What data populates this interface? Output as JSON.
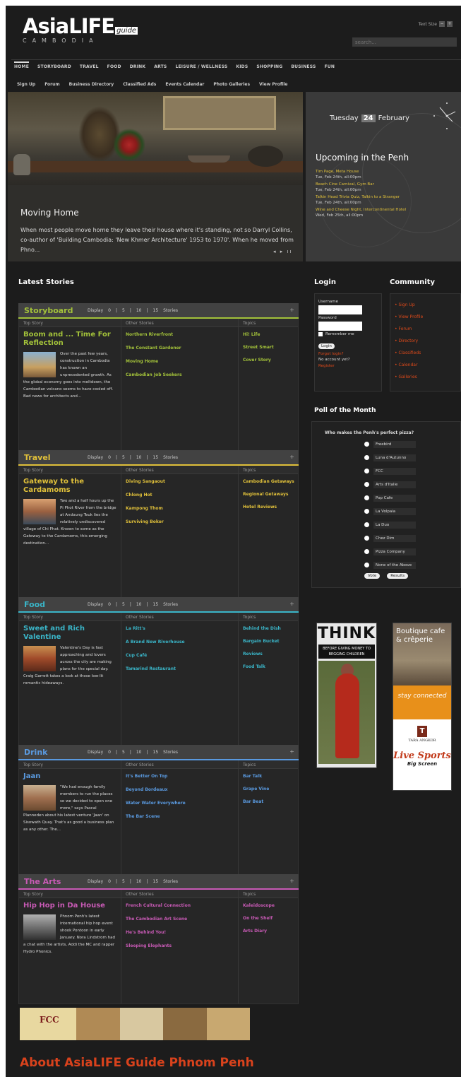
{
  "header": {
    "logo": "AsiaLIFE",
    "logo_guide": "guide",
    "logo_sub": "CAMBODIA",
    "text_size_label": "Text Size",
    "text_minus": "−",
    "text_plus": "+",
    "search_placeholder": "search..."
  },
  "nav": [
    "HOME",
    "STORYBOARD",
    "TRAVEL",
    "FOOD",
    "DRINK",
    "ARTS",
    "LEISURE / WELLNESS",
    "KIDS",
    "SHOPPING",
    "BUSINESS",
    "FUN"
  ],
  "subnav": [
    "Sign Up",
    "Forum",
    "Business Directory",
    "Classified Ads",
    "Events Calendar",
    "Photo Galleries",
    "View Profile"
  ],
  "hero": {
    "title": "Moving Home",
    "text": "When most people move home they leave their house where it's standing, not so Darryl Collins, co-author of 'Building Cambodia: 'New Khmer Architecture' 1953 to 1970'. When he moved from Phno...",
    "arrows": "◂ ▸ ıı"
  },
  "upcoming": {
    "day": "Tuesday",
    "date_num": "24",
    "month": "February",
    "title": "Upcoming in the Penh",
    "events": [
      {
        "name": "Tim Page, Meta House",
        "date": "Tue, Feb 24th, all:00pm"
      },
      {
        "name": "Beach Cine Carnival, Gym Bar",
        "date": "Tue, Feb 24th, all:00pm"
      },
      {
        "name": "Talkin Head Trivia Quiz, Talkin to a Stranger",
        "date": "Tue, Feb 24th, all:00pm"
      },
      {
        "name": "Wine and Cheese Night, Intercontinental Hotel",
        "date": "Wed, Feb 25th, all:00pm"
      }
    ]
  },
  "latest_title": "Latest Stories",
  "sections": [
    {
      "title": "Storyboard",
      "color": "#a3c23a",
      "display": "Display",
      "counts": [
        "0",
        "|",
        "5",
        "|",
        "10",
        "|",
        "15",
        "Stories"
      ],
      "col_top": "Top Story",
      "col_other": "Other Stories",
      "col_topics": "Topics",
      "top_title": "Boom and ... Time For Reflection",
      "top_text": "Over the past few years, construction in Cambodia has known an unprecedented growth. As the global economy goes into meltdown, the Cambodian volcano seems to have cooled off. Bad news for architects and...",
      "others": [
        "Northern Riverfront",
        "The Constant Gardener",
        "Moving Home",
        "Cambodian Job Seekers"
      ],
      "topics": [
        "Hi! Life",
        "Street Smart",
        "Cover Story"
      ]
    },
    {
      "title": "Travel",
      "color": "#e0c03a",
      "display": "Display",
      "counts": [
        "0",
        "|",
        "5",
        "|",
        "10",
        "|",
        "15",
        "Stories"
      ],
      "col_top": "Top Story",
      "col_other": "Other Stories",
      "col_topics": "Topics",
      "top_title": "Gateway to the Cardamoms",
      "top_text": "Two and a half hours up the Pi Phot River from the bridge at Andoung Teuk lies the relatively undiscovered village of Chi Phat. Known to some as the Gateway to the Cardamoms, this emerging destination...",
      "others": [
        "Diving Sangaout",
        "Chlong Hot",
        "Kampong Thom",
        "Surviving Bokor"
      ],
      "topics": [
        "Cambodian Getaways",
        "Regional Getaways",
        "Hotel Reviews"
      ]
    },
    {
      "title": "Food",
      "color": "#3ab5c8",
      "display": "Display",
      "counts": [
        "0",
        "|",
        "5",
        "|",
        "10",
        "|",
        "15",
        "Stories"
      ],
      "col_top": "Top Story",
      "col_other": "Other Stories",
      "col_topics": "Topics",
      "top_title": "Sweet and Rich Valentine",
      "top_text": "Valentine's Day is fast approaching and lovers across the city are making plans for the special day. Craig Garrett takes a look at those low-lit romantic hideaways.",
      "others": [
        "La Ritt's",
        "A Brand New Riverhouse",
        "Cup Café",
        "Tamarind Restaurant"
      ],
      "topics": [
        "Behind the Dish",
        "Bargain Bucket",
        "Reviews",
        "Food Talk"
      ]
    },
    {
      "title": "Drink",
      "color": "#5a9ae0",
      "display": "Display",
      "counts": [
        "0",
        "|",
        "5",
        "|",
        "10",
        "|",
        "15",
        "Stories"
      ],
      "col_top": "Top Story",
      "col_other": "Other Stories",
      "col_topics": "Topics",
      "top_title": "Jaan",
      "top_text": "\"We had enough family members to run the places so we decided to open one more,\" says Pascal Planneden about his latest venture 'Jaan' on Sisowath Quay. That's as good a business plan as any other. The...",
      "others": [
        "It's Better On Top",
        "Beyond Bordeaux",
        "Water Water Everywhere",
        "The Bar Scene"
      ],
      "topics": [
        "Bar Talk",
        "Grape Vine",
        "Bar Beat"
      ]
    },
    {
      "title": "The Arts",
      "color": "#c85ab5",
      "display": "Display",
      "counts": [
        "0",
        "|",
        "5",
        "|",
        "10",
        "|",
        "15",
        "Stories"
      ],
      "col_top": "Top Story",
      "col_other": "Other Stories",
      "col_topics": "Topics",
      "top_title": "Hip Hop in Da House",
      "top_text": "Phnom Penh's latest international hip hop event shook Pontoon in early January. Nora Lindstrom had a chat with the artists, Addi the MC and rapper Hydro Phonics.",
      "others": [
        "French Cultural Connection",
        "The Cambodian Art Scene",
        "He's Behind You!",
        "Sleeping Elephants"
      ],
      "topics": [
        "Kaleidoscope",
        "On the Shelf",
        "Arts Diary"
      ]
    }
  ],
  "login": {
    "title": "Login",
    "username_label": "Username",
    "password_label": "Password",
    "remember": "Remember me",
    "button": "Login",
    "forgot": "Forgot login?",
    "no_account": "No account yet?",
    "register": "Register"
  },
  "community": {
    "title": "Community",
    "items": [
      "Sign Up",
      "View Profile",
      "Forum",
      "Directory",
      "Classifieds",
      "Calendar",
      "Galleries"
    ]
  },
  "poll": {
    "title": "Poll of the Month",
    "question": "Who makes the Penh's perfect pizza?",
    "options": [
      "Freebird",
      "Luna d'Autunno",
      "FCC",
      "Arts d'Italie",
      "Pop Cafe",
      "La Volpaia",
      "La Duo",
      "Chez Dim",
      "Pizza Company",
      "None of the Above"
    ],
    "vote": "Vote",
    "results": "Results"
  },
  "ads": {
    "think": "THINK",
    "think_sub": "BEFORE GIVING MONEY TO BEGGING CHILDREN",
    "boutique": "Boutique cafe & crêperie",
    "stay": "stay connected",
    "tara_logo": "T",
    "tara": "TARA ANGKOR",
    "live_sports": "Live Sports",
    "big_screen": "Big Screen",
    "fcc": "FCC"
  },
  "about": "About AsiaLIFE Guide Phnom Penh"
}
